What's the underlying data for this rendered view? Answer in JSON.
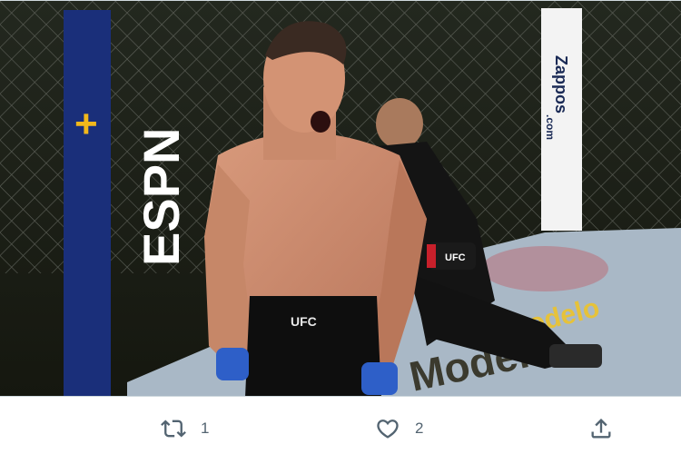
{
  "media": {
    "alt": "UFC fighter celebrating in the octagon",
    "banner_brand": "ESPN",
    "banner_plus": "+",
    "sponsor_post": "Zappos",
    "sponsor_post_sub": ".com",
    "shorts_logo": "UFC",
    "glove_logo": "UFC",
    "canvas_word": "Modelo",
    "mat_word": "Modelo"
  },
  "actions": {
    "retweet_count": "1",
    "like_count": "2",
    "retweet_icon": "retweet-icon",
    "like_icon": "heart-icon",
    "share_icon": "share-icon"
  },
  "colors": {
    "icon_gray": "#536471",
    "espn_blue": "#1a2f7a",
    "plus_yellow": "#f2b81b",
    "canvas": "#a9b8c6"
  }
}
